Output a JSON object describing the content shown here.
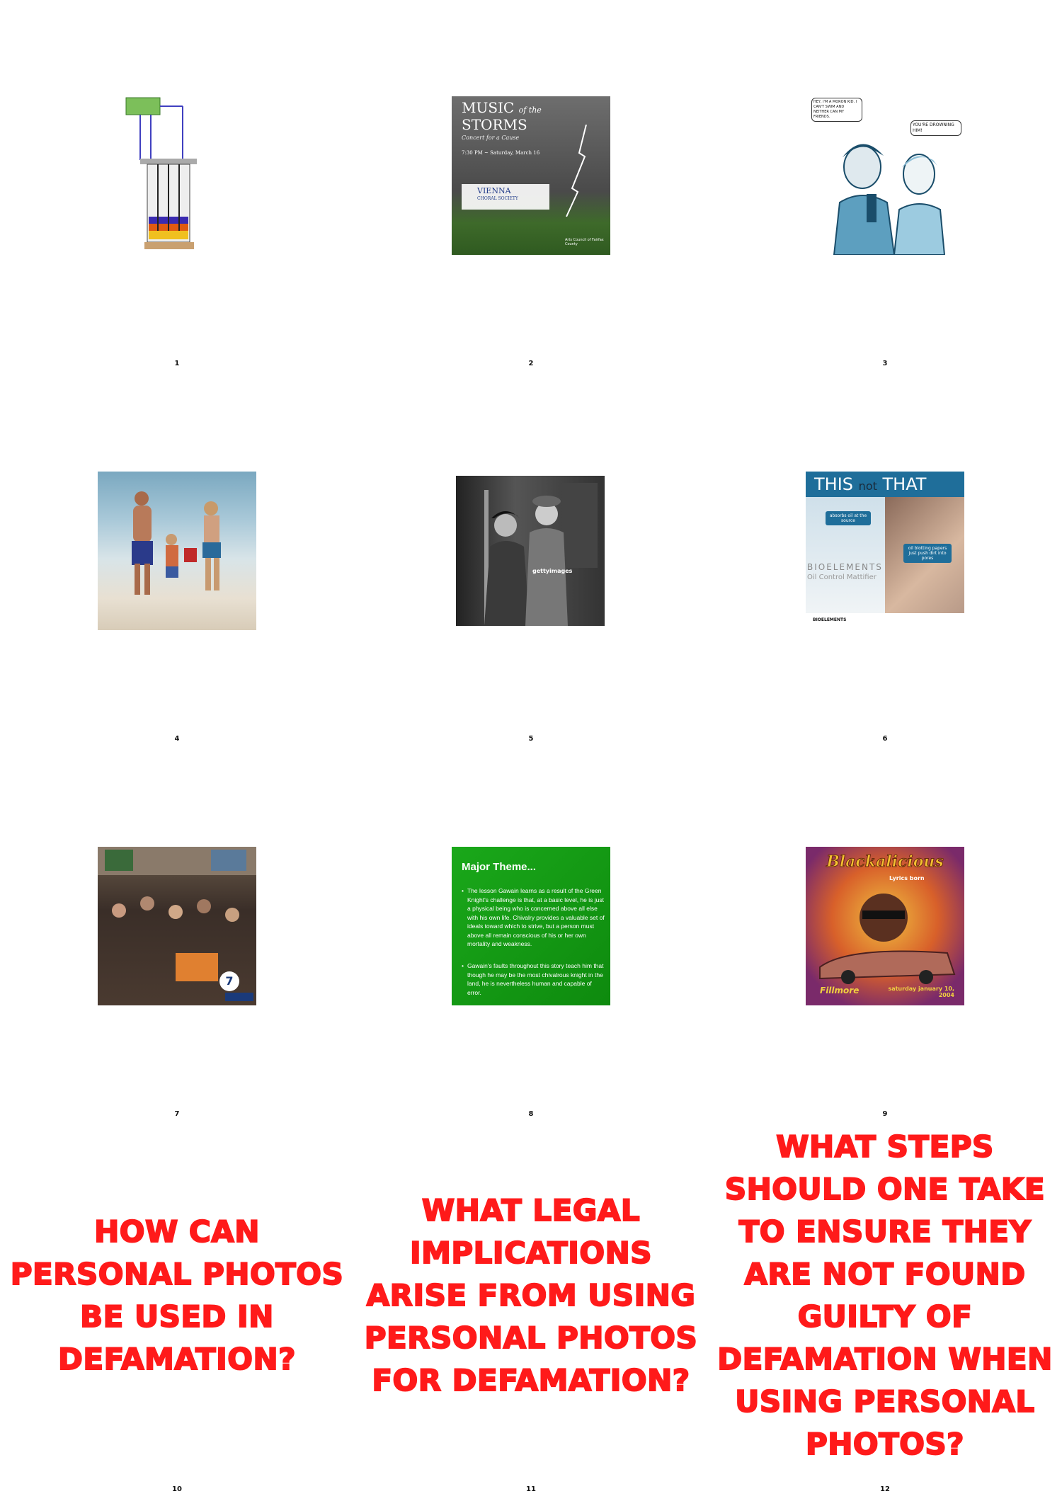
{
  "grid": {
    "items": [
      {
        "number": "1"
      },
      {
        "number": "2",
        "title_line1": "MUSIC",
        "title_of": "of the",
        "title_line2": "STORMS",
        "subtitle": "Concert for a Cause",
        "event_time": "7:30 PM ~ Saturday, March 16",
        "org_name": "VIENNA",
        "org_sub": "CHORAL SOCIETY",
        "sponsor": "Arts Council of Fairfax County"
      },
      {
        "number": "3",
        "bubble_left": "HEY, I'M A MORON KID. I CAN'T SWIM AND NEITHER CAN MY FRIENDS.",
        "bubble_right": "YOU'RE DROWNING HIM!"
      },
      {
        "number": "4"
      },
      {
        "number": "5",
        "watermark": "gettyimages"
      },
      {
        "number": "6",
        "title_this": "THIS",
        "title_not": "not",
        "title_that": "THAT",
        "bubble_a": "absorbs oil at the source",
        "bubble_b": "oil blotting papers just push dirt into pores",
        "product_brand": "BIOELEMENTS",
        "product_name": "Oil Control Mattifier",
        "footer_brand": "BIOELEMENTS"
      },
      {
        "number": "7",
        "logo": "7"
      },
      {
        "number": "8",
        "heading": "Major Theme...",
        "bullet1": "The lesson Gawain learns as a result of the Green Knight's challenge is that, at a basic level, he is just a physical being who is concerned above all else with his own life. Chivalry provides a valuable set of ideals toward which to strive, but a person must above all remain conscious of his or her own mortality and weakness.",
        "bullet2": "Gawain's faults throughout this story teach him that though he may be the most chivalrous knight in the land, he is nevertheless human and capable of error."
      },
      {
        "number": "9",
        "title": "Blackalicious",
        "subtitle": "Lyrics born",
        "date": "saturday january 10, 2004",
        "venue": "Fillmore"
      },
      {
        "number": "10",
        "question": "HOW CAN PERSONAL PHOTOS BE USED IN DEFAMATION?"
      },
      {
        "number": "11",
        "question": "WHAT LEGAL IMPLICATIONS ARISE FROM USING PERSONAL PHOTOS FOR DEFAMATION?"
      },
      {
        "number": "12",
        "question": "WHAT STEPS SHOULD ONE TAKE TO ENSURE THEY ARE NOT FOUND GUILTY OF DEFAMATION WHEN USING PERSONAL PHOTOS?"
      }
    ]
  },
  "colors": {
    "question_red": "#ff1a1a",
    "slide_green": "#13a013"
  }
}
